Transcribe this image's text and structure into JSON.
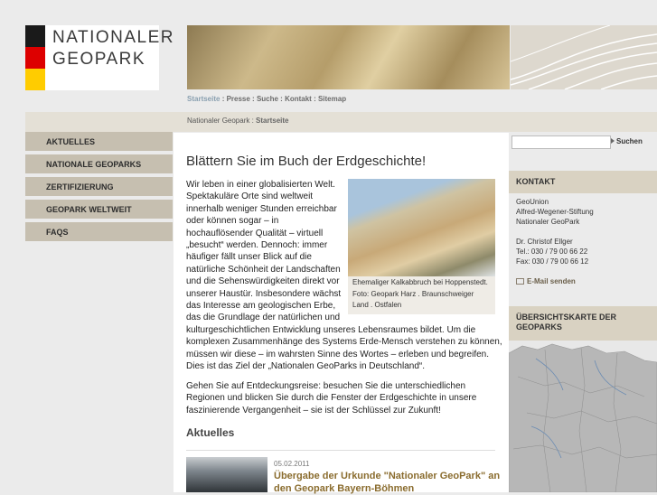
{
  "logo": {
    "line1": "NATIONALER",
    "line2": "GEOPARK",
    "flag_colors": [
      "#1a1a1a",
      "#dd0000",
      "#ffcc00"
    ]
  },
  "topnav": {
    "items": [
      "Startseite",
      "Presse",
      "Suche",
      "Kontakt",
      "Sitemap"
    ],
    "separator": " : "
  },
  "breadcrumb": {
    "items": [
      "Nationaler Geopark",
      "Startseite"
    ]
  },
  "sidebar": {
    "items": [
      {
        "label": "AKTUELLES"
      },
      {
        "label": "NATIONALE GEOPARKS"
      },
      {
        "label": "ZERTIFIZIERUNG"
      },
      {
        "label": "GEOPARK WELTWEIT"
      },
      {
        "label": "FAQS"
      }
    ]
  },
  "main": {
    "title": "Blättern Sie im Buch der Erdgeschichte!",
    "para1_lines": [
      "Wir leben in einer globalisierten Welt.",
      "Spektakuläre Orte sind weltweit",
      "innerhalb weniger Stunden erreichbar",
      "oder können sogar – in",
      "hochauflösender Qualität – virtuell",
      "„besucht“ werden. Dennoch: immer",
      "häufiger fällt unser Blick auf die",
      "natürliche Schönheit der Landschaften",
      "und die Sehenswürdigkeiten direkt vor",
      "unserer Haustür. Insbesondere wächst",
      "das Interesse am geologischen Erbe,",
      "das die Grundlage der natürlichen und",
      "kulturgeschichtlichen Entwicklung unseres Lebensraumes bildet. Um die",
      "komplexen Zusammenhänge des Systems Erde-Mensch verstehen zu können,",
      "müssen wir diese – im wahrsten Sinne des Wortes – erleben und begreifen.",
      "Dies ist das Ziel der „Nationalen GeoParks in Deutschland“."
    ],
    "para2_lines": [
      "Gehen Sie auf Entdeckungsreise: besuchen Sie die unterschiedlichen",
      "Regionen und blicken Sie durch die Fenster der Erdgeschichte in unsere",
      "faszinierende Vergangenheit – sie ist der Schlüssel zur Zukunft!"
    ],
    "caption_lines": [
      "Ehemaliger Kalkabbruch bei Hoppenstedt.",
      "Foto: Geopark Harz . Braunschweiger",
      "Land . Ostfalen"
    ],
    "news_heading": "Aktuelles",
    "news": {
      "date": "05.02.2011",
      "title_line1": "Übergabe der Urkunde \"Nationaler GeoPark\" an",
      "title_line2": "den Geopark Bayern-Böhmen"
    }
  },
  "search": {
    "value": "",
    "button_label": "Suchen"
  },
  "kontakt": {
    "heading": "KONTAKT",
    "lines": [
      "GeoUnion",
      "Alfred-Wegener-Stiftung",
      "Nationaler GeoPark",
      "",
      "Dr. Christof Ellger",
      "Tel.: 030 / 79 00 66 22",
      "Fax: 030 / 79 00 66 12"
    ],
    "email_label": "E-Mail senden"
  },
  "map": {
    "heading_line1": "ÜBERSICHTSKARTE DER",
    "heading_line2": "GEOPARKS"
  }
}
